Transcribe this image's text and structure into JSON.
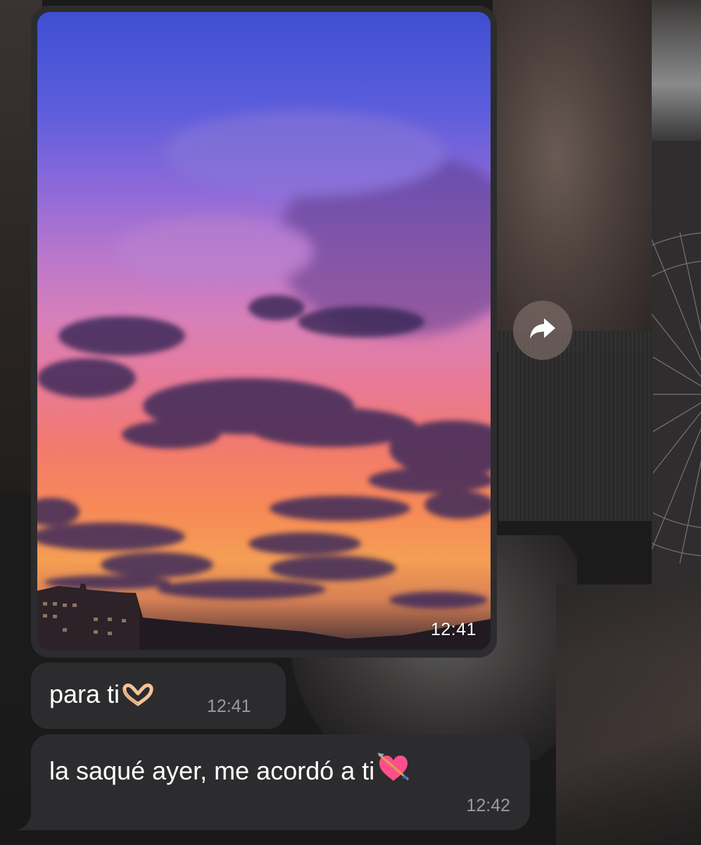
{
  "messages": [
    {
      "type": "image",
      "alt": "sunset sky photo",
      "time": "12:41"
    },
    {
      "type": "text",
      "text": "para ti",
      "emoji": "heart-hands-icon",
      "time": "12:41"
    },
    {
      "type": "text",
      "text": "la saqué ayer, me acordó a ti",
      "emoji": "heart-with-arrow-icon",
      "time": "12:42"
    }
  ],
  "actions": {
    "forward_icon": "forward-arrow-icon"
  },
  "colors": {
    "bubble": "#2c2c2e",
    "timestamp": "#9a9a9e",
    "text": "#ffffff"
  }
}
